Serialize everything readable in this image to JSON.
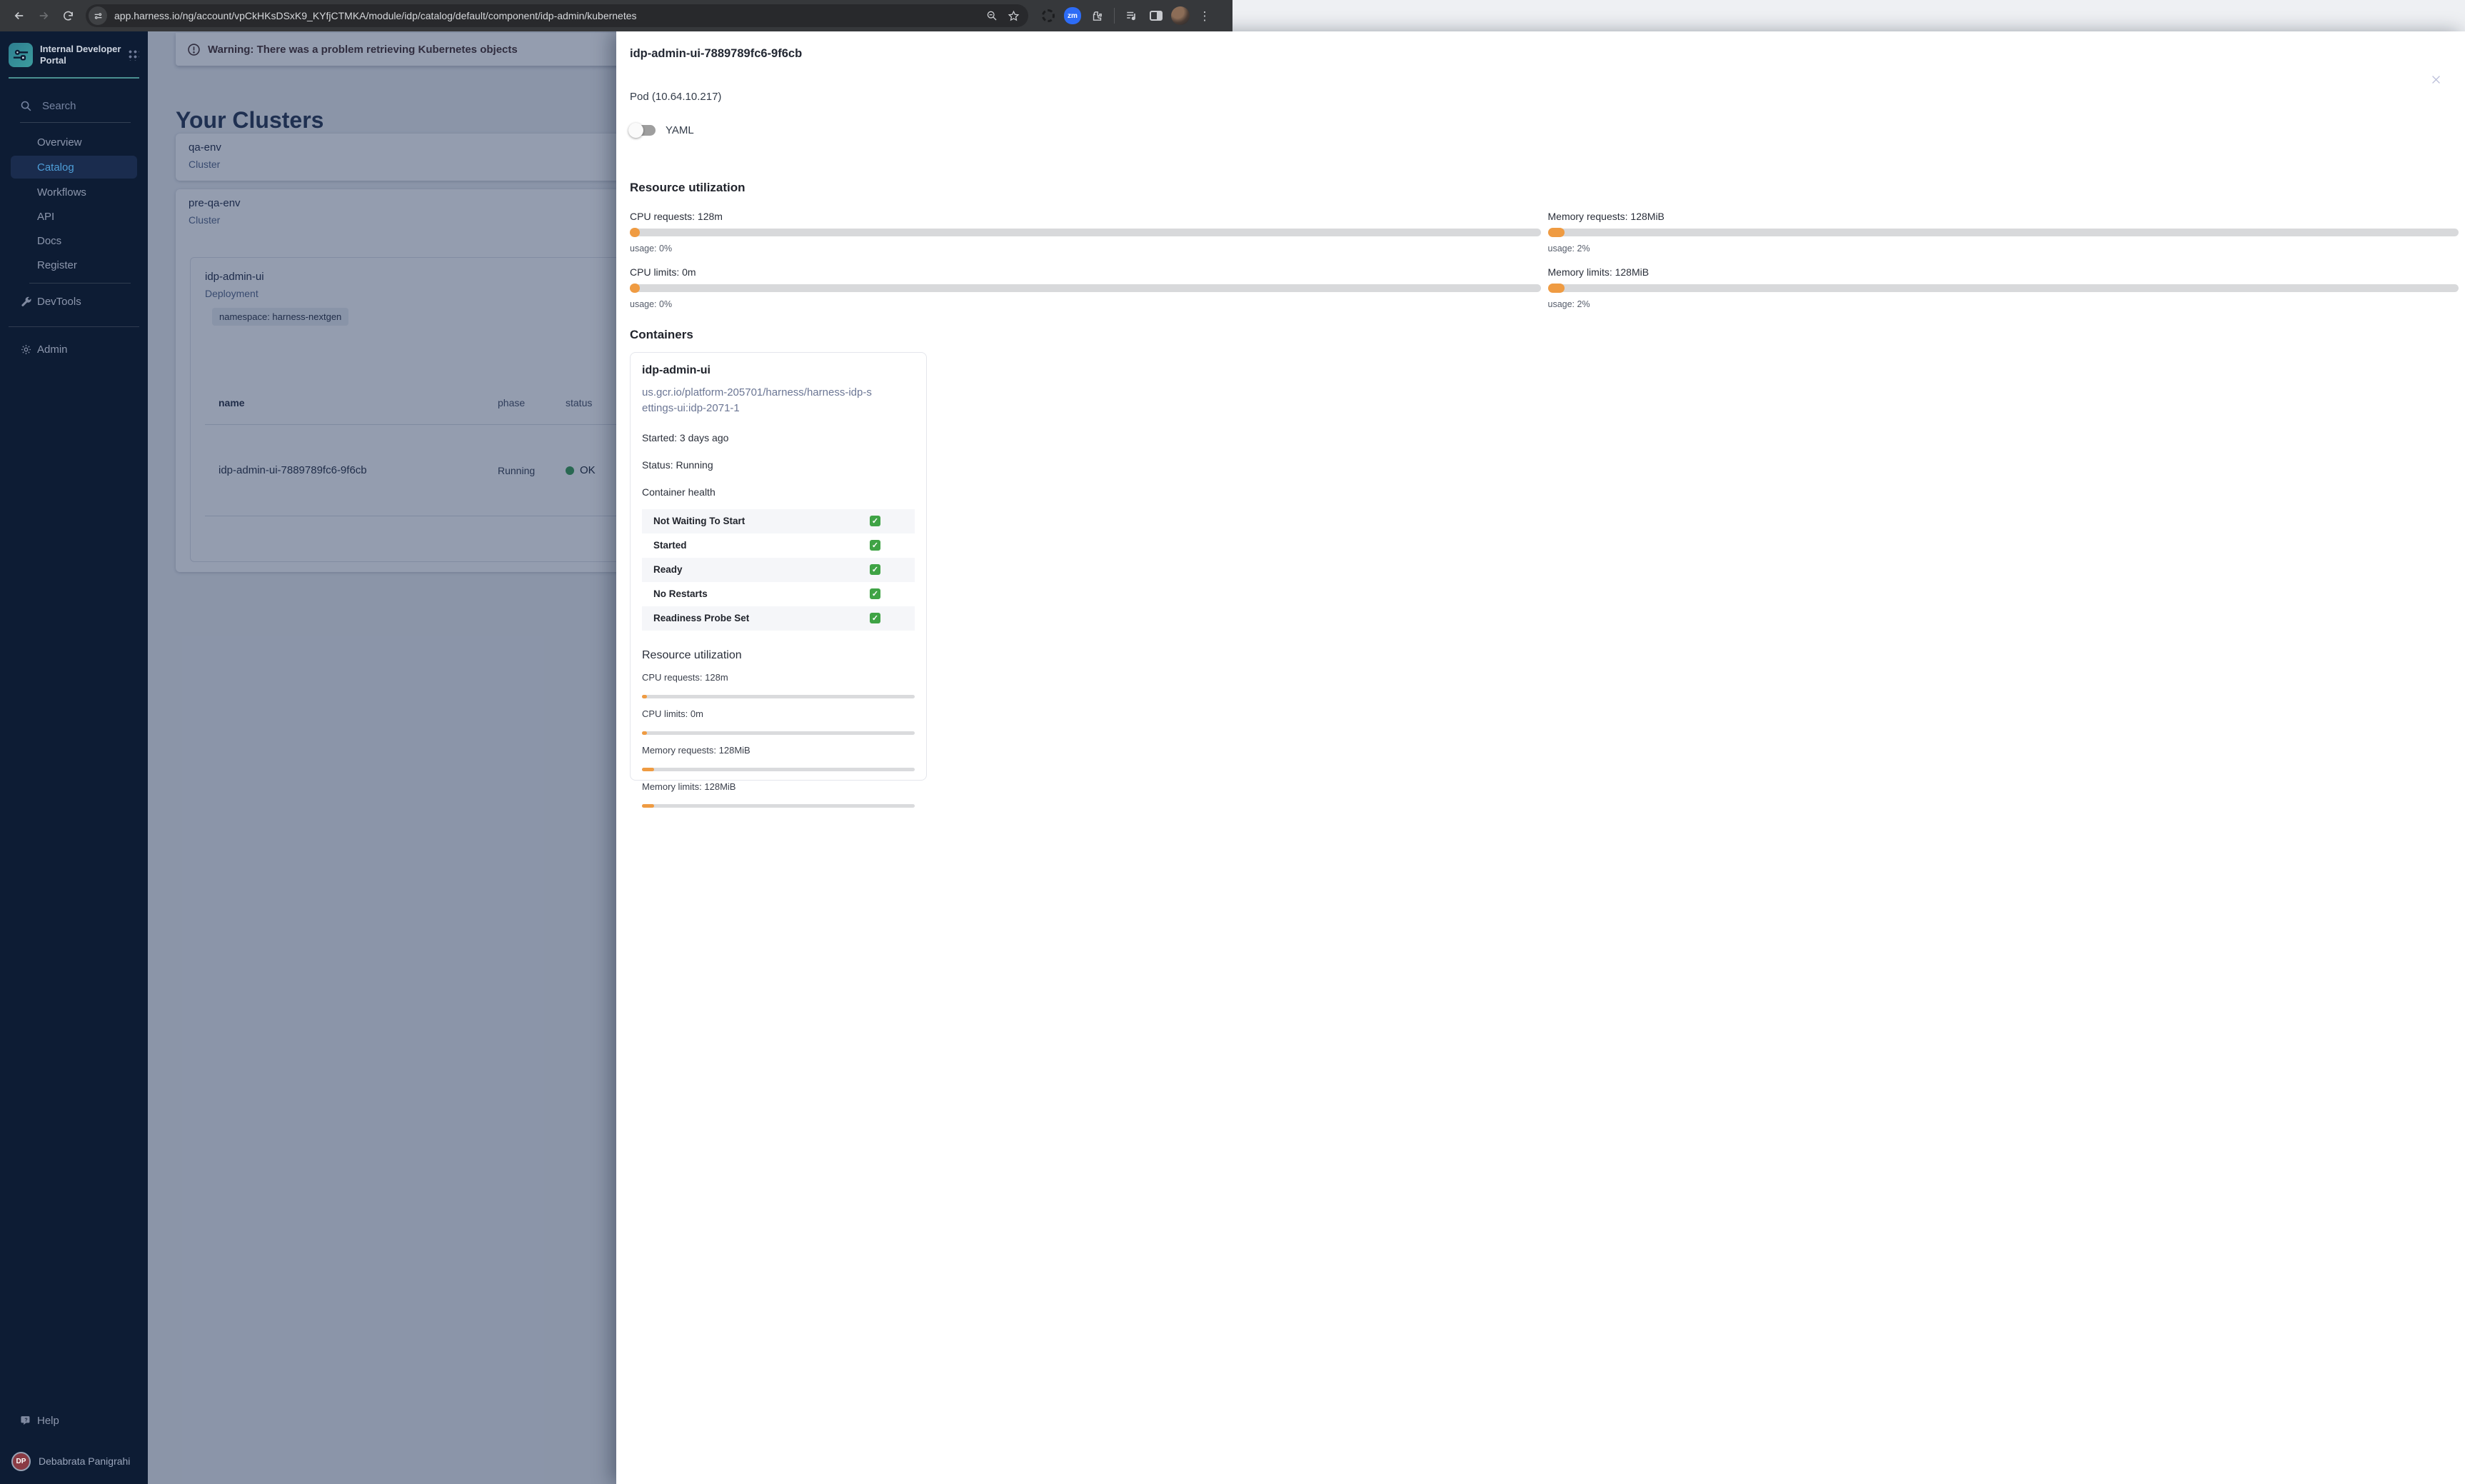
{
  "browser": {
    "url": "app.harness.io/ng/account/vpCkHKsDSxK9_KYfjCTMKA/module/idp/catalog/default/component/idp-admin/kubernetes",
    "zoom_badge": "zm",
    "kebab": "⋮"
  },
  "sidebar": {
    "title": "Internal Developer Portal",
    "search_label": "Search",
    "items": [
      {
        "label": "Overview"
      },
      {
        "label": "Catalog"
      },
      {
        "label": "Workflows"
      },
      {
        "label": "API"
      },
      {
        "label": "Docs"
      },
      {
        "label": "Register"
      }
    ],
    "devtools_label": "DevTools",
    "admin_label": "Admin",
    "help_label": "Help",
    "user": {
      "initials": "DP",
      "name": "Debabrata Panigrahi"
    }
  },
  "main": {
    "warning_text": "Warning: There was a problem retrieving Kubernetes objects",
    "page_title": "Your Clusters",
    "clusters": [
      {
        "name": "qa-env",
        "type": "Cluster"
      },
      {
        "name": "pre-qa-env",
        "type": "Cluster"
      }
    ],
    "deployment": {
      "name": "idp-admin-ui",
      "type": "Deployment",
      "namespace_chip": "namespace: harness-nextgen",
      "table": {
        "columns": {
          "name": "name",
          "phase": "phase",
          "status": "status"
        },
        "row": {
          "name": "idp-admin-ui-7889789fc6-9f6cb",
          "phase": "Running",
          "status": "OK"
        }
      }
    }
  },
  "drawer": {
    "title": "idp-admin-ui-7889789fc6-9f6cb",
    "subtitle": "Pod (10.64.10.217)",
    "yaml_label": "YAML",
    "resource_section": {
      "title": "Resource utilization",
      "metrics": [
        {
          "label": "CPU requests: 128m",
          "usage": "usage: 0%"
        },
        {
          "label": "Memory requests: 128MiB",
          "usage": "usage: 2%"
        },
        {
          "label": "CPU limits: 0m",
          "usage": "usage: 0%"
        },
        {
          "label": "Memory limits: 128MiB",
          "usage": "usage: 2%"
        }
      ]
    },
    "containers_section": {
      "title": "Containers",
      "card": {
        "name": "idp-admin-ui",
        "image": "us.gcr.io/platform-205701/harness/harness-idp-settings-ui:idp-2071-1",
        "started": "Started: 3 days ago",
        "status": "Status: Running",
        "health_title": "Container health",
        "checks": [
          {
            "label": "Not Waiting To Start",
            "value": "✓"
          },
          {
            "label": "Started",
            "value": "✓"
          },
          {
            "label": "Ready",
            "value": "✓"
          },
          {
            "label": "No Restarts",
            "value": "✓"
          },
          {
            "label": "Readiness Probe Set",
            "value": "✓"
          }
        ],
        "resource_title": "Resource utilization",
        "metrics": [
          {
            "label": "CPU requests: 128m"
          },
          {
            "label": "CPU limits: 0m"
          },
          {
            "label": "Memory requests: 128MiB"
          },
          {
            "label": "Memory limits: 128MiB"
          }
        ]
      }
    }
  }
}
